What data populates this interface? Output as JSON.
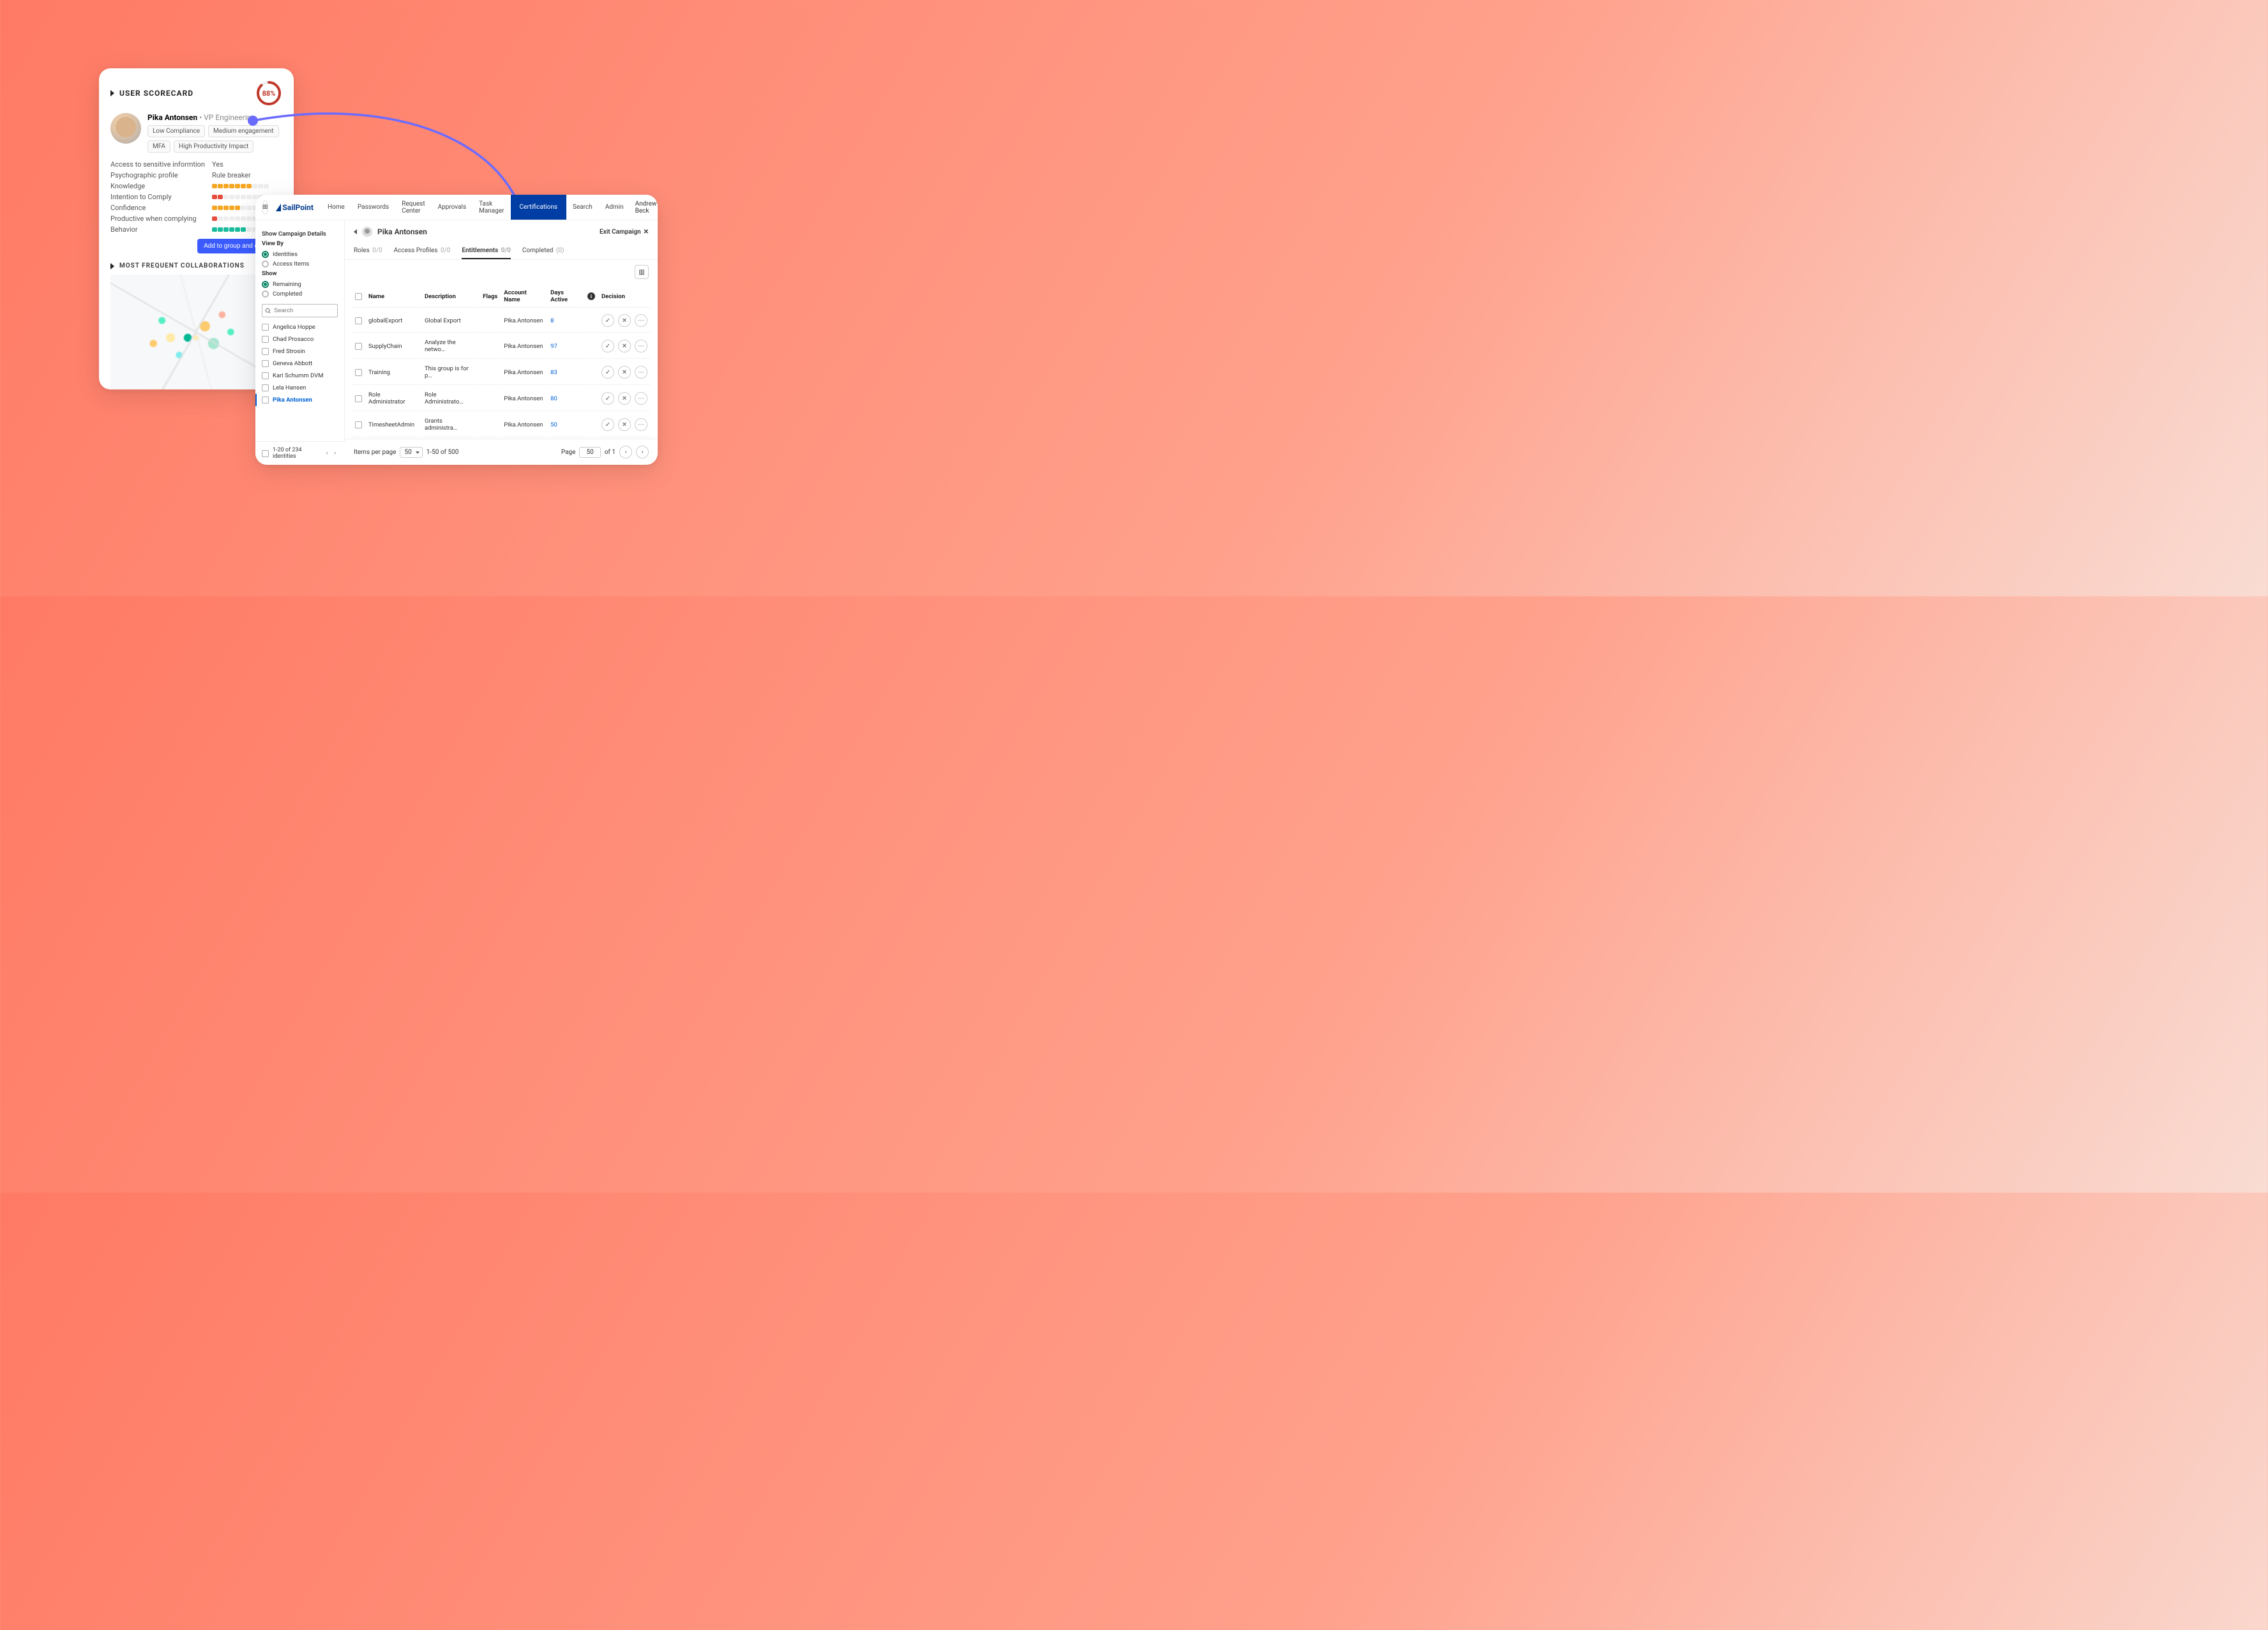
{
  "scorecard": {
    "title": "USER SCORECARD",
    "score": "88%",
    "score_pct": 88,
    "name": "Pika Antonsen",
    "role": "VP Engineering",
    "tags": [
      "Low Compliance",
      "Medium engagement",
      "MFA",
      "High Productivity Impact"
    ],
    "rows": [
      {
        "label": "Access to sensitive informtion",
        "val": "Yes",
        "type": "text"
      },
      {
        "label": "Psychographic profile",
        "val": "Rule breaker",
        "type": "text"
      },
      {
        "label": "Knowledge",
        "type": "pills",
        "fill": 7,
        "color": "or"
      },
      {
        "label": "Intention to Comply",
        "type": "pills",
        "fill": 2,
        "color": "rd"
      },
      {
        "label": "Confidence",
        "type": "pills",
        "fill": 5,
        "color": "or"
      },
      {
        "label": "Productive when complying",
        "type": "pills",
        "fill": 1,
        "color": "rd"
      },
      {
        "label": "Behavior",
        "type": "pills",
        "fill": 6,
        "color": "tl"
      }
    ],
    "cta": "Add to group and engage",
    "collab_title": "MOST FREQUENT COLLABORATIONS"
  },
  "sailpoint": {
    "brand": "SailPoint",
    "nav": [
      "Home",
      "Passwords",
      "Request Center",
      "Approvals",
      "Task Manager",
      "Certifications",
      "Search",
      "Admin"
    ],
    "nav_active": "Certifications",
    "user": "Andrew Beck",
    "side": {
      "campaign_link": "Show Campaign Details",
      "viewby_label": "View By",
      "viewby_opts": [
        "Identities",
        "Access Items"
      ],
      "viewby_sel": "Identities",
      "show_label": "Show",
      "show_opts": [
        "Remaining",
        "Completed"
      ],
      "show_sel": "Remaining",
      "search_ph": "Search",
      "identities": [
        "Angelica Hoppe",
        "Chad Prosacco",
        "Fred Strosin",
        "Geneva Abbott",
        "Kari Schumm DVM",
        "Lela Hansen",
        "Pika Antonsen"
      ],
      "identity_sel": "Pika Antonsen",
      "pager": "1-20 of 234 identities"
    },
    "main": {
      "title": "Pika Antonsen",
      "exit": "Exit Campaign",
      "tabs": [
        {
          "label": "Roles",
          "cnt": "0/0"
        },
        {
          "label": "Access Profiles",
          "cnt": "0/0"
        },
        {
          "label": "Entitlements",
          "cnt": "0/0"
        },
        {
          "label": "Completed",
          "cnt": "(0)"
        }
      ],
      "tab_active": "Entitlements",
      "cols": [
        "Name",
        "Description",
        "Flags",
        "Account Name",
        "Days Active",
        "",
        "Decision"
      ],
      "rows": [
        {
          "name": "globalExport",
          "desc": "Global Export",
          "flags": "",
          "acct": "Pika.Antonsen",
          "days": "8"
        },
        {
          "name": "SupplyChain",
          "desc": "Analyze the netwo…",
          "flags": "",
          "acct": "Pika.Antonsen",
          "days": "97"
        },
        {
          "name": "Training",
          "desc": "This group is for p…",
          "flags": "",
          "acct": "Pika.Antonsen",
          "days": "83"
        },
        {
          "name": "Role Administrator",
          "desc": "Role Administrato…",
          "flags": "",
          "acct": "Pika.Antonsen",
          "days": "80"
        },
        {
          "name": "TimesheetAdmin",
          "desc": "Grants administra…",
          "flags": "",
          "acct": "Pika.Antonsen",
          "days": "50"
        }
      ],
      "ipp_label": "Items per page",
      "ipp_val": "50",
      "range": "1-50 of 500",
      "page_label": "Page",
      "page_val": "50",
      "page_of": "of 1"
    }
  }
}
